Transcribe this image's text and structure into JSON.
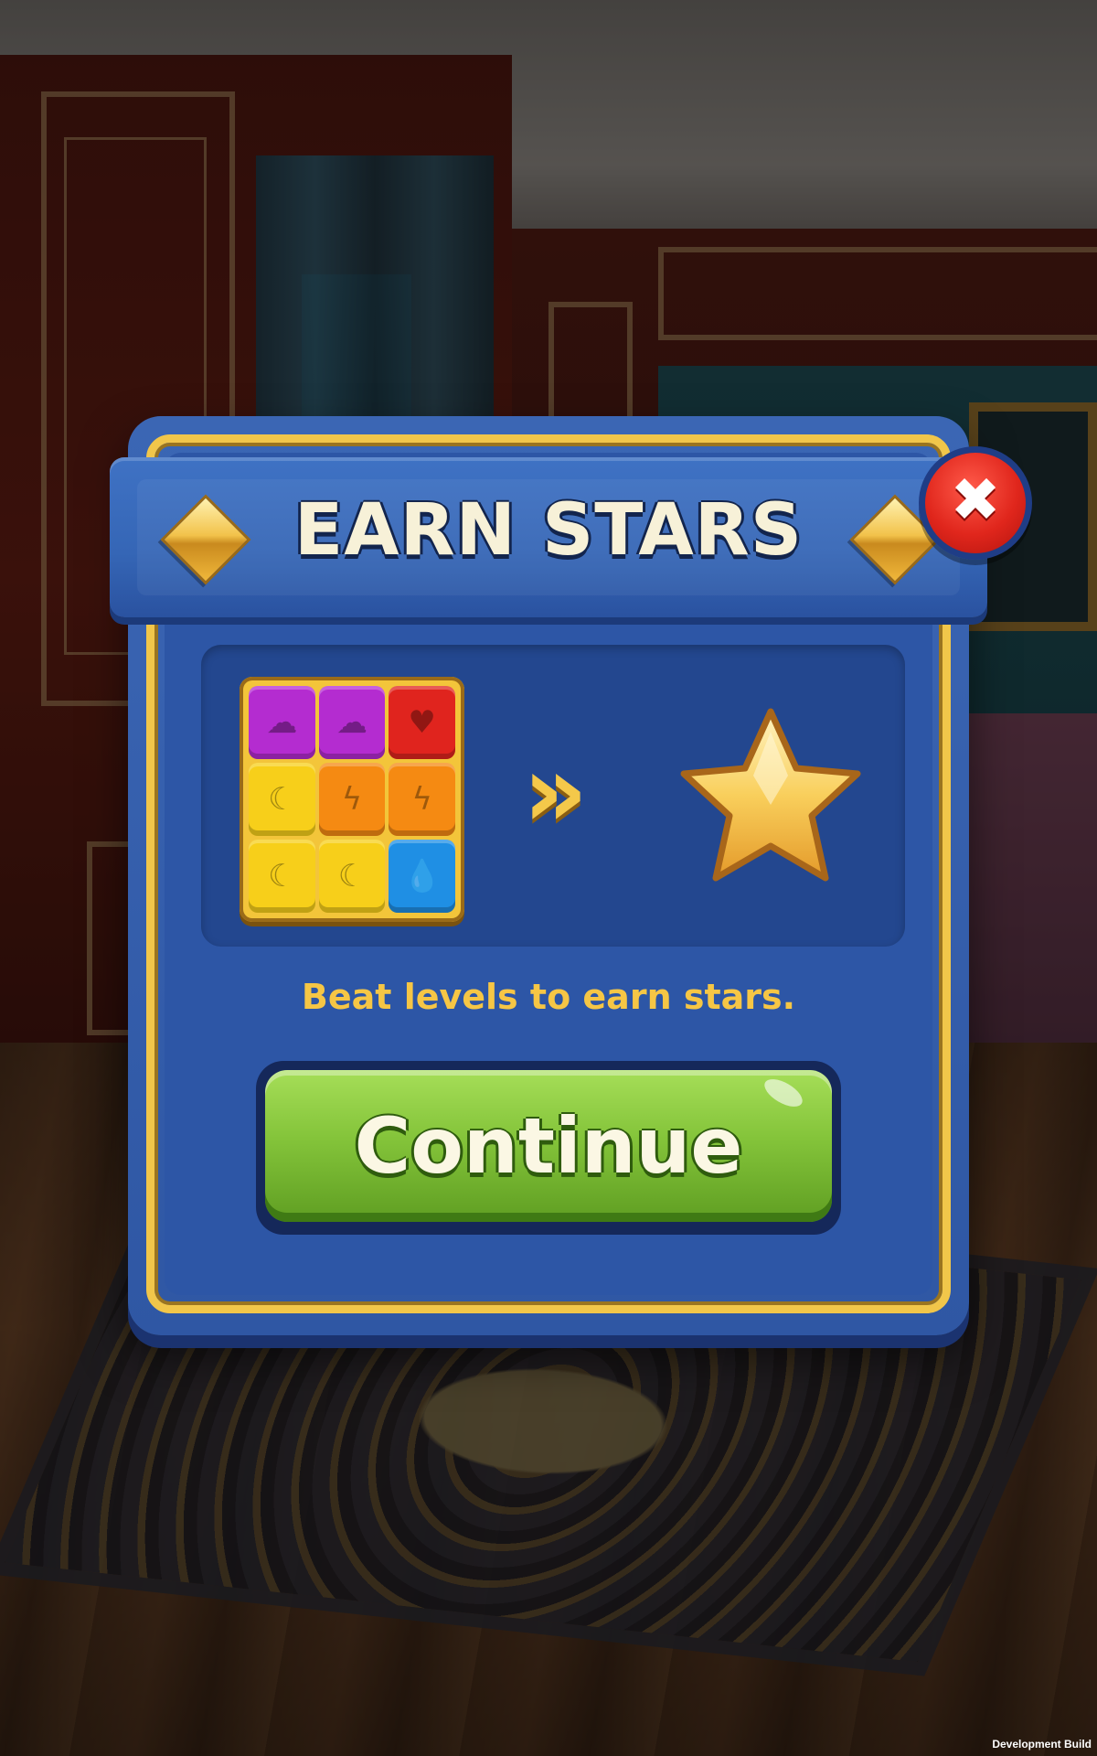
{
  "dialog": {
    "title": "EARN STARS",
    "close_icon": "close-icon",
    "description": "Beat levels to earn stars.",
    "continue_label": "Continue",
    "arrows_glyph": "»",
    "illustration": {
      "tiles": [
        {
          "color": "purple",
          "icon": "cloud-icon",
          "glyph": "☁"
        },
        {
          "color": "purple",
          "icon": "cloud-icon",
          "glyph": "☁"
        },
        {
          "color": "red",
          "icon": "heart-icon",
          "glyph": "♥"
        },
        {
          "color": "yellow",
          "icon": "moon-icon",
          "glyph": "☾"
        },
        {
          "color": "orange",
          "icon": "lightning-icon",
          "glyph": "ϟ"
        },
        {
          "color": "orange",
          "icon": "lightning-icon",
          "glyph": "ϟ"
        },
        {
          "color": "yellow",
          "icon": "moon-icon",
          "glyph": "☾"
        },
        {
          "color": "yellow",
          "icon": "moon-icon",
          "glyph": "☾"
        },
        {
          "color": "blue",
          "icon": "droplet-icon",
          "glyph": "💧"
        }
      ],
      "reward_icon": "star-icon"
    }
  },
  "footer": {
    "build_label": "Development Build"
  },
  "colors": {
    "dialog_blue": "#2f57a4",
    "gold": "#f1c64a",
    "button_green": "#84c43a",
    "close_red": "#e0261c",
    "subtitle_yellow": "#f6c645"
  }
}
